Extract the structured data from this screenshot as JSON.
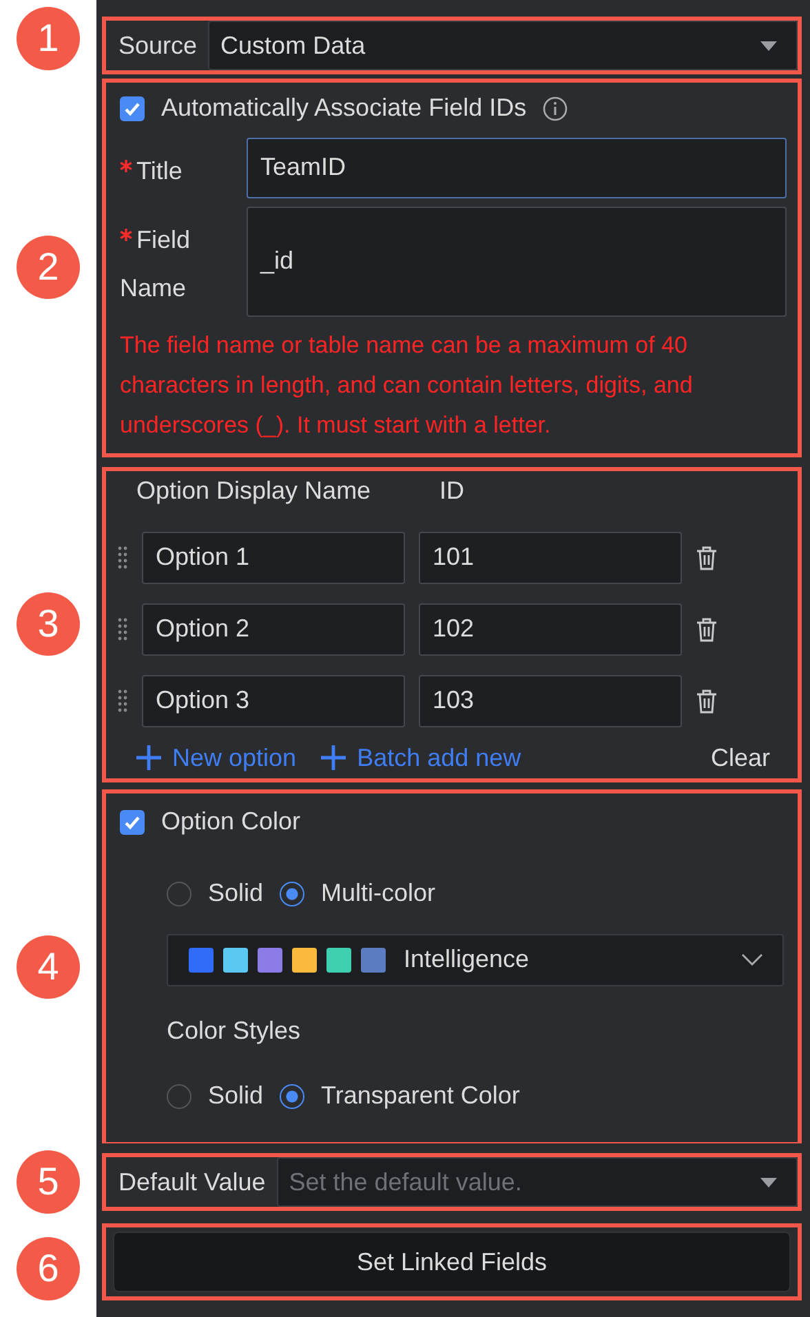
{
  "source": {
    "callout": "1",
    "label": "Source",
    "value": "Custom Data"
  },
  "field": {
    "callout": "2",
    "auto_associate": {
      "label": "Automatically Associate Field IDs",
      "checked": true
    },
    "title": {
      "label": "Title",
      "value": "TeamID"
    },
    "field_name": {
      "label_line1": "Field",
      "label_line2": "Name",
      "value": "_id"
    },
    "error": "The field name or table name can be a maximum of 40 characters in length, and can contain letters, digits, and underscores (_). It must start with a letter."
  },
  "options": {
    "callout": "3",
    "columns": [
      "Option Display Name",
      "ID"
    ],
    "rows": [
      {
        "name": "Option 1",
        "id": "101"
      },
      {
        "name": "Option 2",
        "id": "102"
      },
      {
        "name": "Option 3",
        "id": "103"
      }
    ],
    "actions": [
      "New option",
      "Batch add new"
    ],
    "clear": "Clear"
  },
  "option_color": {
    "callout": "4",
    "checkbox": {
      "label": "Option Color",
      "checked": true
    },
    "mode": [
      {
        "label": "Solid",
        "selected": false
      },
      {
        "label": "Multi-color",
        "selected": true
      }
    ],
    "palette": {
      "name": "Intelligence",
      "swatches": [
        {
          "color": "#2f6bf6"
        },
        {
          "color": "#5ac8f0"
        },
        {
          "color": "#8c7ae6"
        },
        {
          "color": "#f8b93c"
        },
        {
          "color": "#3ecfae"
        },
        {
          "color": "#5b7cc0"
        }
      ]
    },
    "styles_label": "Color Styles",
    "styles": [
      {
        "label": "Solid",
        "selected": false
      },
      {
        "label": "Transparent Color",
        "selected": true
      }
    ]
  },
  "default_value": {
    "callout": "5",
    "label": "Default Value",
    "placeholder": "Set the default value."
  },
  "linked": {
    "callout": "6",
    "button": "Set Linked Fields"
  }
}
